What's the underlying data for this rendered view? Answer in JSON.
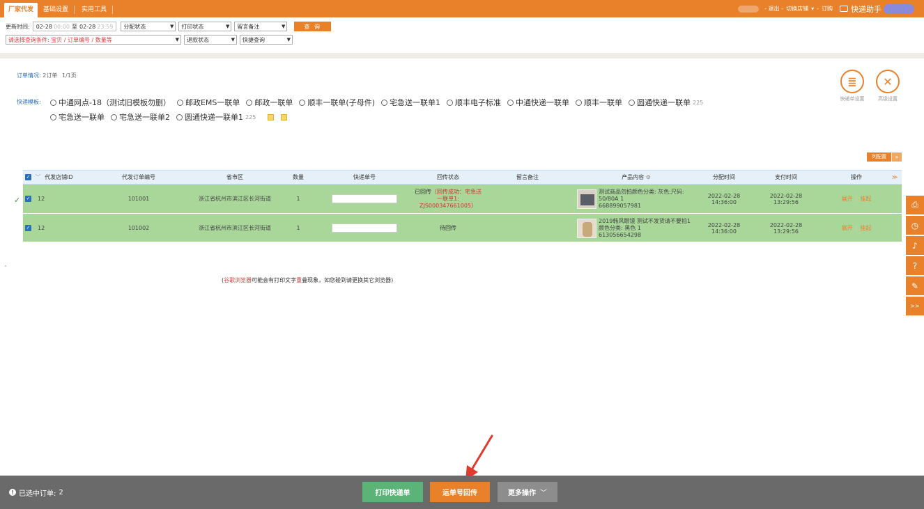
{
  "tabs": [
    {
      "label": "厂家代发",
      "active": true
    },
    {
      "label": "基础设置",
      "active": false
    },
    {
      "label": "实用工具",
      "active": false
    }
  ],
  "top_right": {
    "logout": "- 退出 -",
    "switch_shop": "切换店铺",
    "switch_caret": "▾",
    "sep": "-",
    "order_link": "订购",
    "helper": "快递助手"
  },
  "query": {
    "update_time_label": "更新时间:",
    "date_from": "02-28",
    "time_from": "00:00",
    "date_to_word": "至",
    "date_to": "02-28",
    "time_to": "23:59",
    "alloc_status": "分配状态",
    "print_status": "打印状态",
    "remark": "留言备注",
    "query_button": "查 询",
    "condition_placeholder": "请选择查询条件: 宝贝 / 订单编号 / 数量等",
    "refund_status": "退款状态",
    "quick_query": "快捷查询"
  },
  "order_info": {
    "label": "订单情况:",
    "count": "2订单",
    "pages": "1/1页"
  },
  "templates": {
    "label": "快递模板:",
    "row1": [
      {
        "name": "中通网点-18（测试旧模板勿删）",
        "count": ""
      },
      {
        "name": "邮政EMS一联单",
        "count": ""
      },
      {
        "name": "邮政一联单",
        "count": ""
      },
      {
        "name": "顺丰一联单(子母件)",
        "count": ""
      },
      {
        "name": "宅急送一联单1",
        "count": ""
      },
      {
        "name": "顺丰电子标准",
        "count": ""
      },
      {
        "name": "中通快递一联单",
        "count": ""
      },
      {
        "name": "顺丰一联单",
        "count": ""
      },
      {
        "name": "圆通快递一联单",
        "count": "225"
      }
    ],
    "row2": [
      {
        "name": "宅急送一联单",
        "count": ""
      },
      {
        "name": "宅急送一联单2",
        "count": ""
      },
      {
        "name": "圆通快递一联单1",
        "count": "225"
      }
    ]
  },
  "settings": {
    "waybill": "快递单设置",
    "advanced": "高级设置"
  },
  "column_config": {
    "label": "列配置",
    "chevron": "»"
  },
  "table": {
    "headers": {
      "shop_id": "代发店铺ID",
      "order_no": "代发订单编号",
      "region": "省市区",
      "qty": "数量",
      "waybill": "快递单号",
      "status": "回传状态",
      "remark": "留言备注",
      "product": "产品内容",
      "alloc_time": "分配时间",
      "pay_time": "支付时间",
      "action": "操作"
    },
    "rows": [
      {
        "shop_id": "12",
        "order_no": "101001",
        "region": "浙江省杭州市滨江区长河街道",
        "qty": "1",
        "status_main": "已回传",
        "status_detail": "（回传成功：宅急送一联单1: ZJS000347661005）",
        "product_text": "测试商品勿拍颜色分类: 灰色;尺码: 50/80A 1",
        "product_code": "668899057981",
        "alloc_time": "2022-02-28 14:36:00",
        "pay_time": "2022-02-28 13:29:56",
        "action_open": "展开",
        "action_hang": "挂起"
      },
      {
        "shop_id": "12",
        "order_no": "101002",
        "region": "浙江省杭州市滨江区长河街道",
        "qty": "1",
        "status_main": "待回传",
        "status_detail": "",
        "product_text": "2019韩风眼镜 测试不发货请不要拍1颜色分类: 黑色 1",
        "product_code": "613056654298",
        "alloc_time": "2022-02-28 14:36:00",
        "pay_time": "2022-02-28 13:29:56",
        "action_open": "展开",
        "action_hang": "挂起"
      }
    ]
  },
  "notice": {
    "pre": "(",
    "browser": "谷歌浏览器",
    "mid": "可能会有打印文字",
    "word": "重",
    "post": "叠现象，如您碰到请更换其它浏览器)"
  },
  "bottom": {
    "selected_label": "已选中订单:",
    "selected_count": "2",
    "print_button": "打印快递单",
    "upload_button": "运单号回传",
    "more_button": "更多操作"
  },
  "colors": {
    "accent": "#e8812a",
    "row_green": "#a9d79a",
    "link_blue": "#2a6ebd",
    "bottom_bar": "#6a6a6a"
  }
}
